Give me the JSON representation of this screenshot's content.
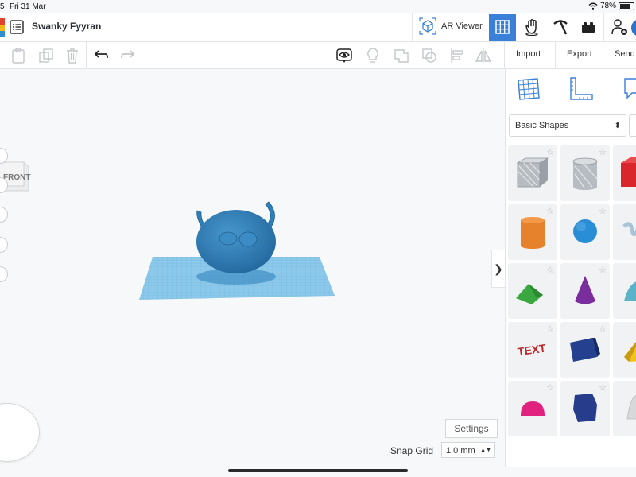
{
  "status_bar": {
    "time": "5",
    "date": "Fri 31 Mar",
    "battery": "78%",
    "battery_level": 0.78
  },
  "topbar": {
    "design_title": "Swanky Fyyran",
    "ar_viewer_label": "AR Viewer",
    "view_buttons": [
      "3d-design-view",
      "codeblocks",
      "bricks",
      "blocks"
    ]
  },
  "toolbar": {
    "import_label": "Import",
    "export_label": "Export",
    "send_label": "Send"
  },
  "viewport": {
    "view_cube_label": "FRONT",
    "settings_label": "Settings",
    "snap_grid_label": "Snap Grid",
    "snap_grid_value": "1.0 mm"
  },
  "panel": {
    "category": "Basic Shapes",
    "shapes": [
      {
        "name": "box-striped",
        "color": "#b7bcc2"
      },
      {
        "name": "cylinder-striped",
        "color": "#b7bcc2"
      },
      {
        "name": "box",
        "color": "#d9262c"
      },
      {
        "name": "cylinder",
        "color": "#e5822b"
      },
      {
        "name": "sphere",
        "color": "#2a8ed6"
      },
      {
        "name": "scribble",
        "color": "#a9c3d9"
      },
      {
        "name": "roof",
        "color": "#3aa741"
      },
      {
        "name": "cone",
        "color": "#7a2d9c"
      },
      {
        "name": "round-roof",
        "color": "#5ab3c9"
      },
      {
        "name": "text",
        "color": "#c0262b"
      },
      {
        "name": "wedge",
        "color": "#24408f"
      },
      {
        "name": "pyramid",
        "color": "#f1c21b"
      },
      {
        "name": "half-sphere",
        "color": "#e1237f"
      },
      {
        "name": "polygon",
        "color": "#283c8c"
      },
      {
        "name": "paraboloid",
        "color": "#d6d8da"
      }
    ]
  },
  "colors": {
    "accent": "#3a7fd8",
    "model": "#2f7fb8",
    "workplane": "#8cc8ea"
  }
}
